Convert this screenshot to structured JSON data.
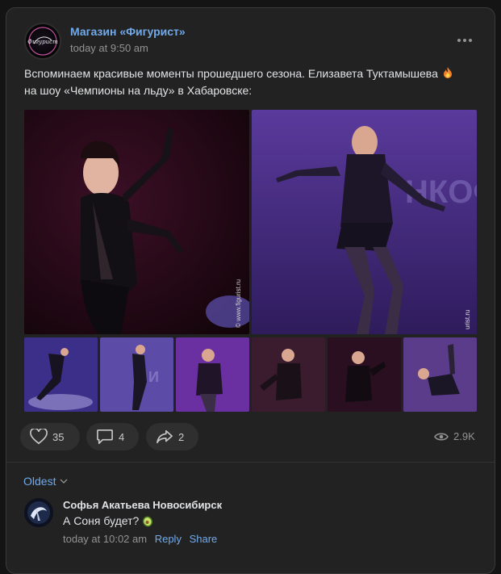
{
  "post": {
    "author": "Магазин «Фигурист»",
    "avatar_text": "Фигурист",
    "time": "today at 9:50 am",
    "text_line1": "Вспоминаем красивые моменты прошедшего сезона. Елизавета Туктамышева",
    "text_line2": "на шоу «Чемпионы на льду» в Хабаровске:",
    "photo1_watermark": "© www.figurist.ru",
    "photo2_watermark": "urist.ru",
    "photo2_sign": "НКОФ"
  },
  "actions": {
    "likes": "35",
    "comments": "4",
    "shares": "2",
    "views": "2.9K"
  },
  "comments": {
    "sort_label": "Oldest",
    "items": [
      {
        "author": "Софья Акатьева Новосибирск",
        "text": "А Соня будет?",
        "time": "today at 10:02 am",
        "reply": "Reply",
        "share": "Share"
      }
    ]
  },
  "icons": {
    "more": "more-dots-icon",
    "like": "heart-icon",
    "comment": "comment-icon",
    "share": "share-icon",
    "views": "eye-icon",
    "fire": "fire-emoji",
    "avocado": "avocado-emoji"
  },
  "colors": {
    "accent": "#71aaeb",
    "background": "#141414",
    "card": "#222222"
  }
}
